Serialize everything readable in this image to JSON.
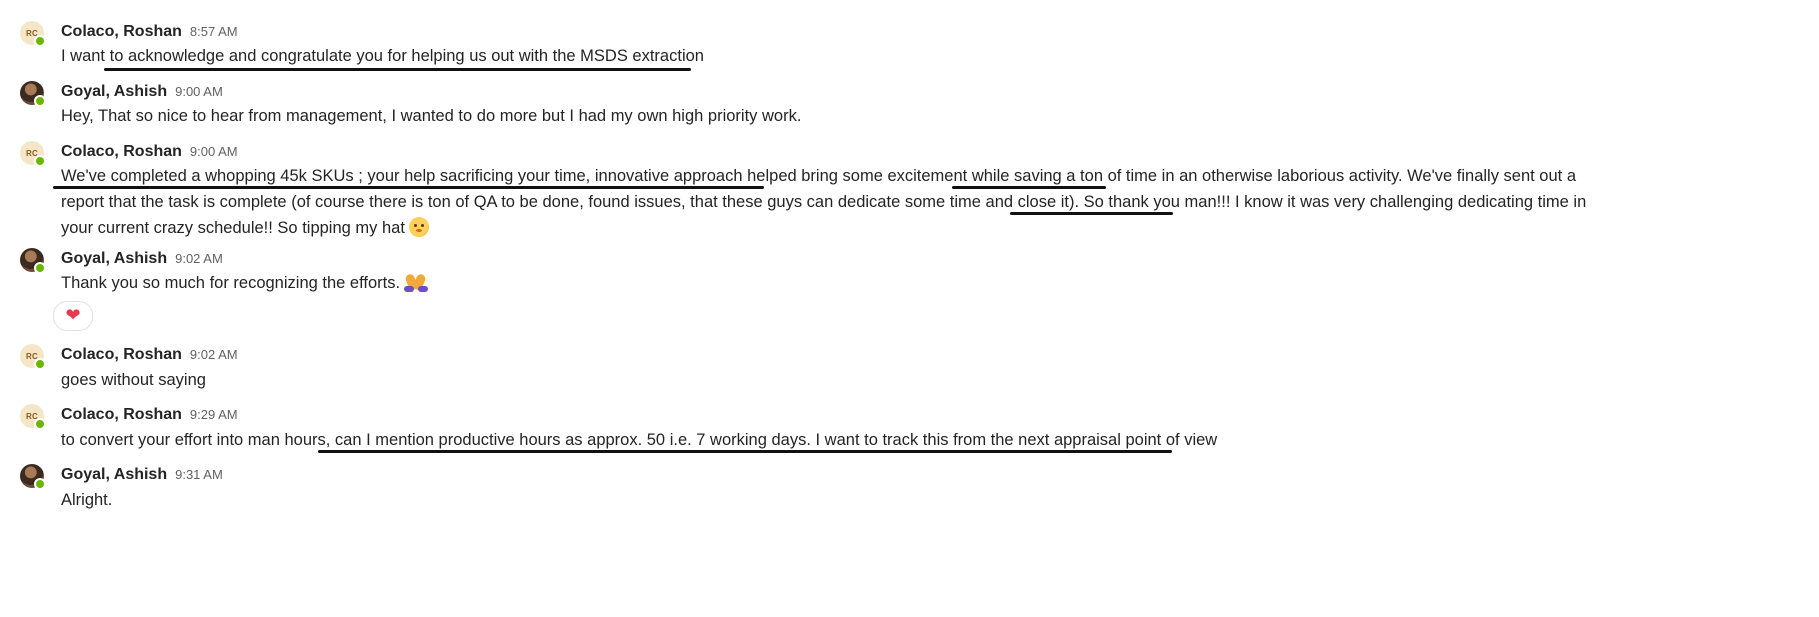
{
  "messages": [
    {
      "author": "Colaco, Roshan",
      "time": "8:57 AM",
      "avatar_initials": "RC",
      "lines": [
        "I want to acknowledge and congratulate you for helping us out with the MSDS extraction"
      ]
    },
    {
      "author": "Goyal, Ashish",
      "time": "9:00 AM",
      "lines": [
        "Hey, That so nice to hear from management, I wanted to do more but I had my own high priority work."
      ]
    },
    {
      "author": "Colaco, Roshan",
      "time": "9:00 AM",
      "avatar_initials": "RC",
      "lines": [
        "We've completed a whopping 45k SKUs ; your help sacrificing your time, innovative approach helped bring some excitement while saving a ton of time in an otherwise laborious activity. We've finally sent out a",
        "report that the task is complete (of course there is ton of QA to be done, found issues, that these guys can dedicate some time and close it). So thank you man!!! I know it was very challenging dedicating time in",
        "your current crazy schedule!! So tipping my hat"
      ],
      "emoji": "smiling-face-emoji"
    },
    {
      "author": "Goyal, Ashish",
      "time": "9:02 AM",
      "lines": [
        "Thank you so much for recognizing the efforts."
      ],
      "emoji": "folded-hands-emoji",
      "reaction": "heart-reaction"
    },
    {
      "author": "Colaco, Roshan",
      "time": "9:02 AM",
      "avatar_initials": "RC",
      "lines": [
        "goes without saying"
      ]
    },
    {
      "author": "Colaco, Roshan",
      "time": "9:29 AM",
      "avatar_initials": "RC",
      "lines": [
        "to convert your effort into man hours, can I mention productive hours as approx. 50 i.e. 7 working days. I want to track this from the next appraisal point of view"
      ]
    },
    {
      "author": "Goyal, Ashish",
      "time": "9:31 AM",
      "lines": [
        "Alright."
      ]
    }
  ],
  "colors": {
    "presence": "#6bb700",
    "reaction_heart": "#e8384f",
    "underline": "#111111"
  }
}
